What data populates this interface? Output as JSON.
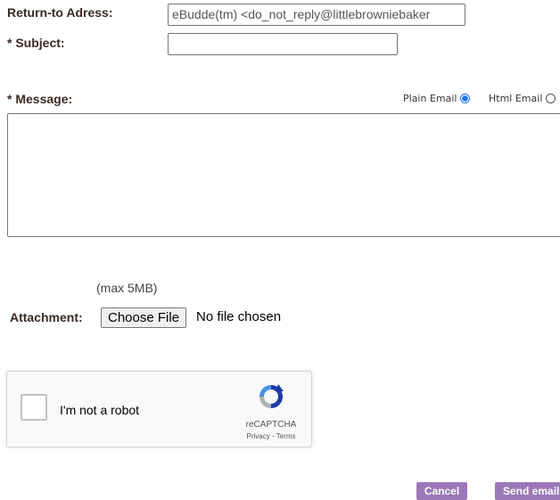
{
  "form": {
    "return_address_label": "Return-to Adress:",
    "return_address_value": "eBudde(tm) <do_not_reply@littlebrowniebaker",
    "subject_label": "* Subject:",
    "subject_value": "",
    "message_label": "* Message:",
    "format_options": [
      {
        "label": "Plain Email",
        "selected": true
      },
      {
        "label": "Html Email",
        "selected": false
      }
    ],
    "message_value": ""
  },
  "attachment": {
    "max_size_note": "(max 5MB)",
    "label": "Attachment:",
    "choose_button_label": "Choose File",
    "status_text": "No file chosen"
  },
  "captcha": {
    "checkbox_label": "I'm not a robot",
    "brand": "reCAPTCHA",
    "links": "Privacy - Terms",
    "icon": "recaptcha-logo",
    "colors": {
      "blue": "#1c3aa9",
      "light_blue": "#4a90e2",
      "gray": "#b0b0b0"
    }
  },
  "actions": {
    "cancel_label": "Cancel",
    "send_label": "Send email"
  },
  "colors": {
    "label_text": "#3a2a22",
    "button_bg": "#9b78b8",
    "radio_selected": "#1a73e8"
  }
}
